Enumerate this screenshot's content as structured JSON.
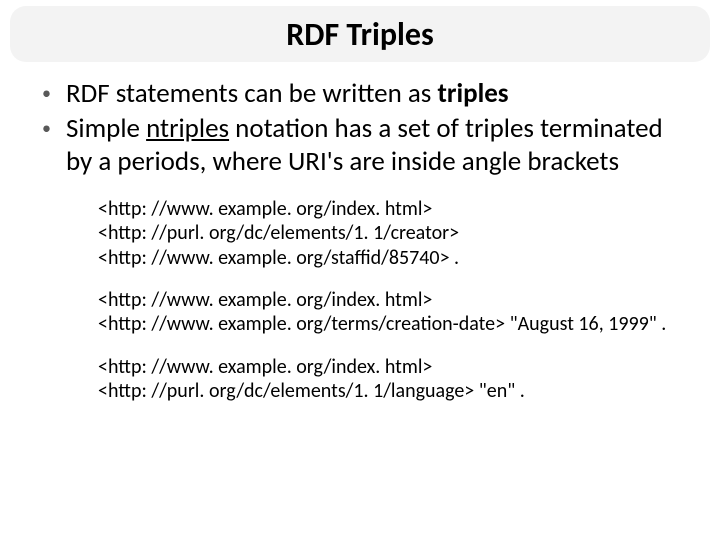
{
  "title": "RDF Triples",
  "bullets": [
    {
      "pre": "RDF statements can be written as ",
      "em": "triples",
      "post": ""
    },
    {
      "pre": "Simple ",
      "em": "ntriples",
      "post": " notation has a set of triples terminated by a periods, where URI's are inside angle brackets"
    }
  ],
  "examples": [
    "<http: //www. example. org/index. html>\n<http: //purl. org/dc/elements/1. 1/creator>\n<http: //www. example. org/staffid/85740> .",
    "<http: //www. example. org/index. html>\n<http: //www. example. org/terms/creation-date> \"August 16, 1999\" .",
    "<http: //www. example. org/index. html>\n<http: //purl. org/dc/elements/1. 1/language> \"en\" ."
  ]
}
